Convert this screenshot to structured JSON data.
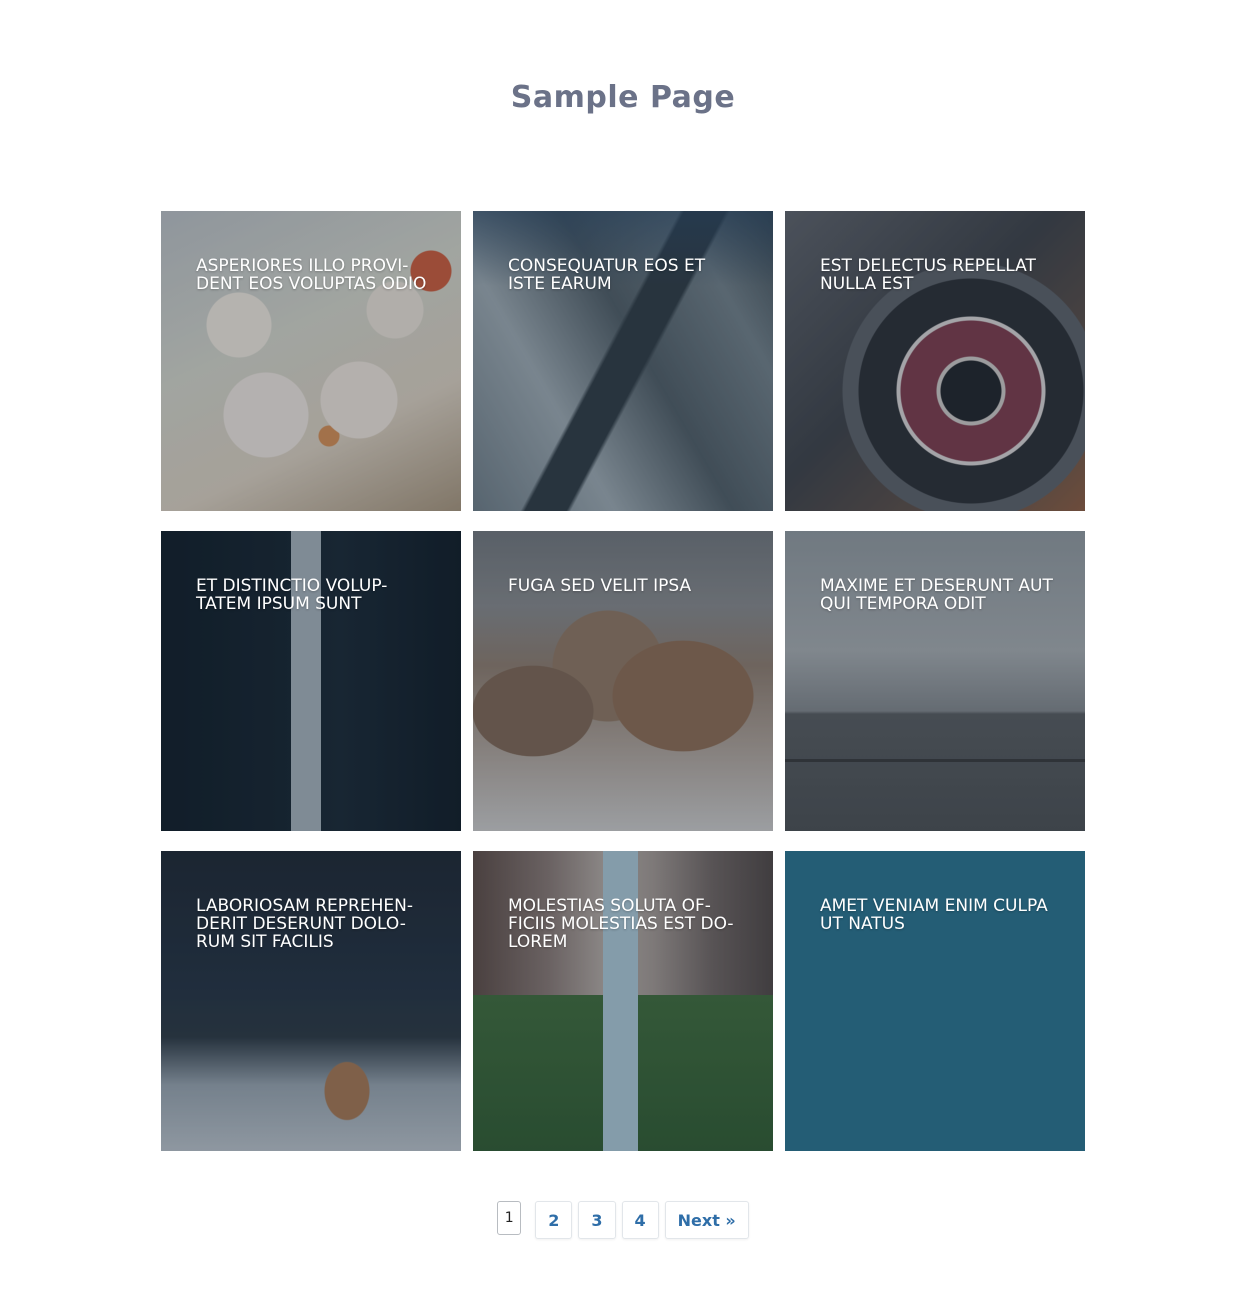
{
  "page": {
    "title": "Sample Page"
  },
  "grid": {
    "tiles": [
      {
        "caption": "ASPERIORES ILLO PROVI-DENT EOS VOLUPTAS ODIO",
        "image": "food-spring-rolls"
      },
      {
        "caption": "CONSEQUATUR EOS ET ISTE EARUM",
        "image": "snowy-mountains"
      },
      {
        "caption": "EST DELECTUS REPELLAT NULLA EST",
        "image": "dj-turntable"
      },
      {
        "caption": "ET DISTINCTIO VOLUP-TATEM IPSUM SUNT",
        "image": "cn-tower"
      },
      {
        "caption": "FUGA SED VELIT IPSA",
        "image": "walruses"
      },
      {
        "caption": "MAXIME ET DESERUNT AUT QUI TEMPORA ODIT",
        "image": "bench-wall"
      },
      {
        "caption": "LABORIOSAM REPREHEN-DERIT DESERUNT DOLO-RUM SIT FACILIS",
        "image": "snowy-cabin"
      },
      {
        "caption": "MOLESTIAS SOLUTA OF-FICIIS MOLESTIAS EST DO-LOREM",
        "image": "city-street"
      },
      {
        "caption": "AMET VENIAM ENIM CULPA UT NATUS",
        "image": "none"
      }
    ]
  },
  "pagination": {
    "current": "1",
    "pages": [
      "2",
      "3",
      "4"
    ],
    "next_label": "Next »"
  },
  "colors": {
    "title": "#6b7288",
    "link": "#2f6ea8",
    "solid_tile": "#245d75"
  }
}
